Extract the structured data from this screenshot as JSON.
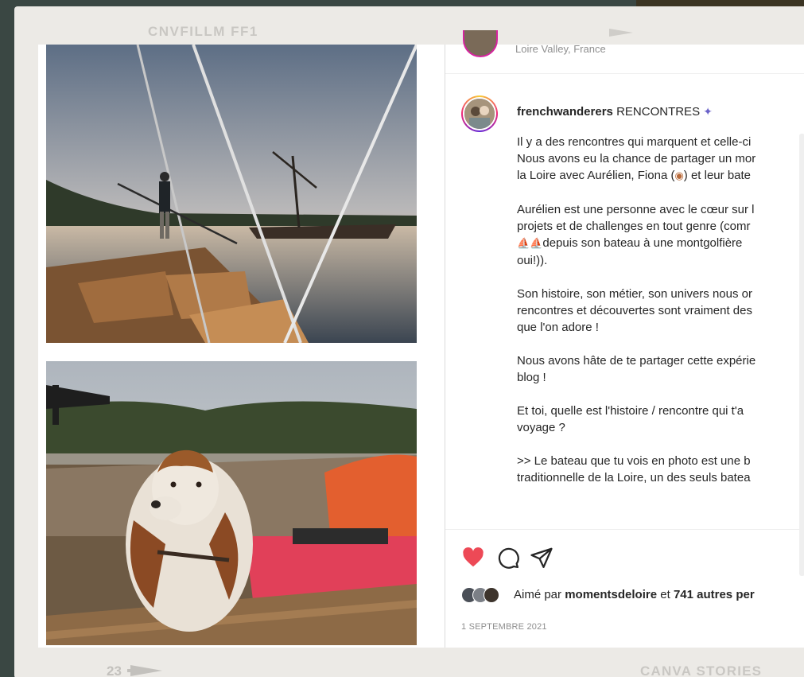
{
  "film": {
    "top_label": "CNVFILLM FF1",
    "frame_number": "23",
    "bottom_label": "CANVA STORIES"
  },
  "post": {
    "location": "Loire Valley, France",
    "username": "frenchwanderers",
    "caption_title": "RENCONTRES",
    "caption_lines": [
      [
        "Il y a des rencontres qui marquent et celle-ci",
        "Nous avons eu la chance de partager un mor",
        "la Loire avec Aurélien, Fiona (",
        ") et leur bate"
      ],
      [
        "Aurélien est une personne avec le cœur sur l",
        "projets et de challenges en tout genre (comr",
        "depuis son bateau à une montgolfière",
        "oui!))."
      ],
      [
        "Son histoire, son métier, son univers nous or",
        "rencontres et découvertes sont vraiment des",
        "que l'on adore !"
      ],
      [
        "Nous avons hâte de te partager cette expérie",
        "blog !"
      ],
      [
        "Et toi, quelle est l'histoire / rencontre qui t'a",
        "voyage ?"
      ],
      [
        ">> Le bateau que tu vois en photo est une b",
        "traditionnelle de la Loire, un des seuls batea"
      ]
    ],
    "liked_by_prefix": "Aimé par",
    "liked_by_user": "momentsdeloire",
    "liked_by_mid": "et",
    "liked_by_others": "741 autres per",
    "date": "1 SEPTEMBRE 2021",
    "icons": {
      "like": "heart-icon",
      "comment": "comment-icon",
      "share": "send-icon",
      "next": "chevron-right-icon"
    },
    "colors": {
      "like": "#ed4956",
      "text": "#262626",
      "muted": "#8e8e8e"
    }
  }
}
